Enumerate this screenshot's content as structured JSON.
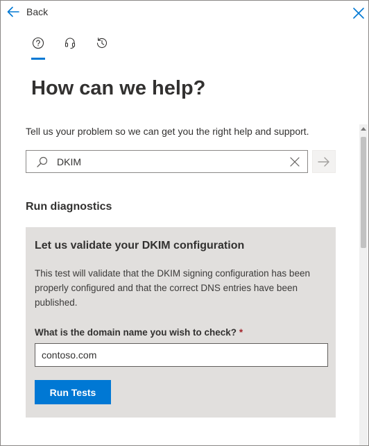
{
  "nav": {
    "back_label": "Back"
  },
  "tabs": [
    {
      "icon": "help-circle-icon",
      "active": true
    },
    {
      "icon": "headset-icon",
      "active": false
    },
    {
      "icon": "history-icon",
      "active": false
    }
  ],
  "header": {
    "title": "How can we help?"
  },
  "intro": "Tell us your problem so we can get you the right help and support.",
  "search": {
    "value": "DKIM",
    "placeholder": ""
  },
  "diagnostics": {
    "section_title": "Run diagnostics",
    "card_title": "Let us validate your DKIM configuration",
    "description": "This test will validate that the DKIM signing configuration has been properly configured and that the correct DNS entries have been published.",
    "field_label": "What is the domain name you wish to check?",
    "required_mark": "*",
    "domain_value": "contoso.com",
    "run_button": "Run Tests"
  },
  "colors": {
    "accent": "#0078d4",
    "card_bg": "#e1dfdd",
    "required": "#a4262c"
  }
}
